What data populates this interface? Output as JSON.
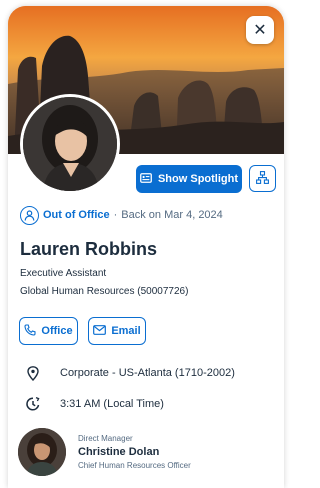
{
  "close_button": {
    "glyph": "✕"
  },
  "spotlight_button": {
    "label": "Show Spotlight",
    "icon": "spotlight-icon"
  },
  "org_chart_button": {
    "icon": "org-chart-icon"
  },
  "status": {
    "label": "Out of Office",
    "separator": "·",
    "detail": "Back on Mar 4, 2024",
    "icon": "person-status-icon"
  },
  "profile": {
    "name": "Lauren Robbins",
    "job_title": "Executive Assistant",
    "department": "Global Human Resources (50007726)"
  },
  "contact_buttons": {
    "office": "Office",
    "email": "Email"
  },
  "location": "Corporate - US-Atlanta (1710-2002)",
  "local_time": "3:31 AM (Local Time)",
  "manager": {
    "role": "Direct Manager",
    "name": "Christine Dolan",
    "title": "Chief Human Resources Officer"
  },
  "colors": {
    "accent": "#0a6ed1",
    "text": "#1d2d3e",
    "muted": "#556b82"
  }
}
